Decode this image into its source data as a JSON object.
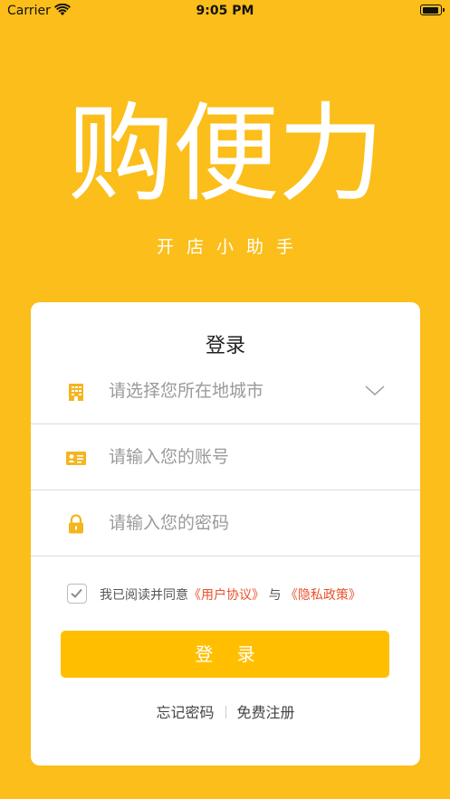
{
  "status_bar": {
    "carrier": "Carrier",
    "time": "9:05 PM",
    "battery_level": 0.95
  },
  "logo": {
    "title": "购便力",
    "tagline": "开店小助手"
  },
  "login_card": {
    "title": "登录",
    "city_select": {
      "placeholder": "请选择您所在地城市",
      "icon": "building-icon"
    },
    "account_field": {
      "placeholder": "请输入您的账号",
      "icon": "id-card-icon"
    },
    "password_field": {
      "placeholder": "请输入您的密码",
      "icon": "lock-icon"
    },
    "agreement": {
      "checked": true,
      "prefix": "我已阅读并同意",
      "user_agreement": "《用户协议》",
      "conjunction": "与",
      "privacy_policy": "《隐私政策》"
    },
    "login_button": "登 录",
    "forgot_password": "忘记密码",
    "register": "免费注册"
  },
  "colors": {
    "background": "#FBBE1A",
    "button": "#FFBF00",
    "link": "#E8512A",
    "icon": "#F4B51E"
  }
}
